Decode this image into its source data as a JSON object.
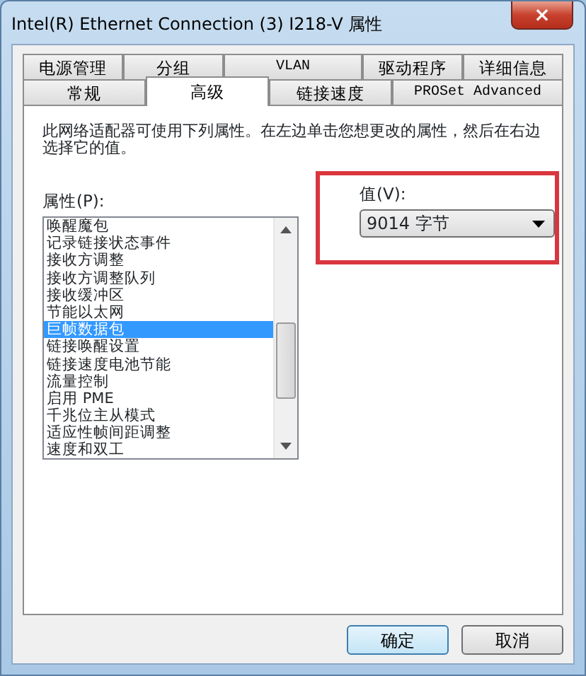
{
  "window": {
    "title": "Intel(R) Ethernet Connection (3) I218-V 属性",
    "close": "×"
  },
  "tab_rows": [
    [
      {
        "label": "电源管理",
        "selected": false
      },
      {
        "label": "分组",
        "selected": false
      },
      {
        "label": "VLAN",
        "selected": false
      },
      {
        "label": "驱动程序",
        "selected": false
      },
      {
        "label": "详细信息",
        "selected": false
      }
    ],
    [
      {
        "label": "常规",
        "selected": false
      },
      {
        "label": "高级",
        "selected": true
      },
      {
        "label": "链接速度",
        "selected": false
      },
      {
        "label": "PROSet Advanced",
        "selected": false
      }
    ]
  ],
  "description": "此网络适配器可使用下列属性。在左边单击您想更改的属性，然后在右边选择它的值。",
  "properties": {
    "label": "属性(P):",
    "items": [
      {
        "label": "唤醒魔包",
        "selected": false
      },
      {
        "label": "记录链接状态事件",
        "selected": false
      },
      {
        "label": "接收方调整",
        "selected": false
      },
      {
        "label": "接收方调整队列",
        "selected": false
      },
      {
        "label": "接收缓冲区",
        "selected": false
      },
      {
        "label": "节能以太网",
        "selected": false
      },
      {
        "label": "巨帧数据包",
        "selected": true
      },
      {
        "label": "链接唤醒设置",
        "selected": false
      },
      {
        "label": "链接速度电池节能",
        "selected": false
      },
      {
        "label": "流量控制",
        "selected": false
      },
      {
        "label": "启用 PME",
        "selected": false
      },
      {
        "label": "千兆位主从模式",
        "selected": false
      },
      {
        "label": "适应性帧间距调整",
        "selected": false
      },
      {
        "label": "速度和双工",
        "selected": false
      }
    ]
  },
  "value": {
    "label": "值(V):",
    "selected_value": "9014 字节",
    "highlighted": true
  },
  "buttons": [
    {
      "label": "确定",
      "default": true
    },
    {
      "label": "取消",
      "default": false
    }
  ]
}
